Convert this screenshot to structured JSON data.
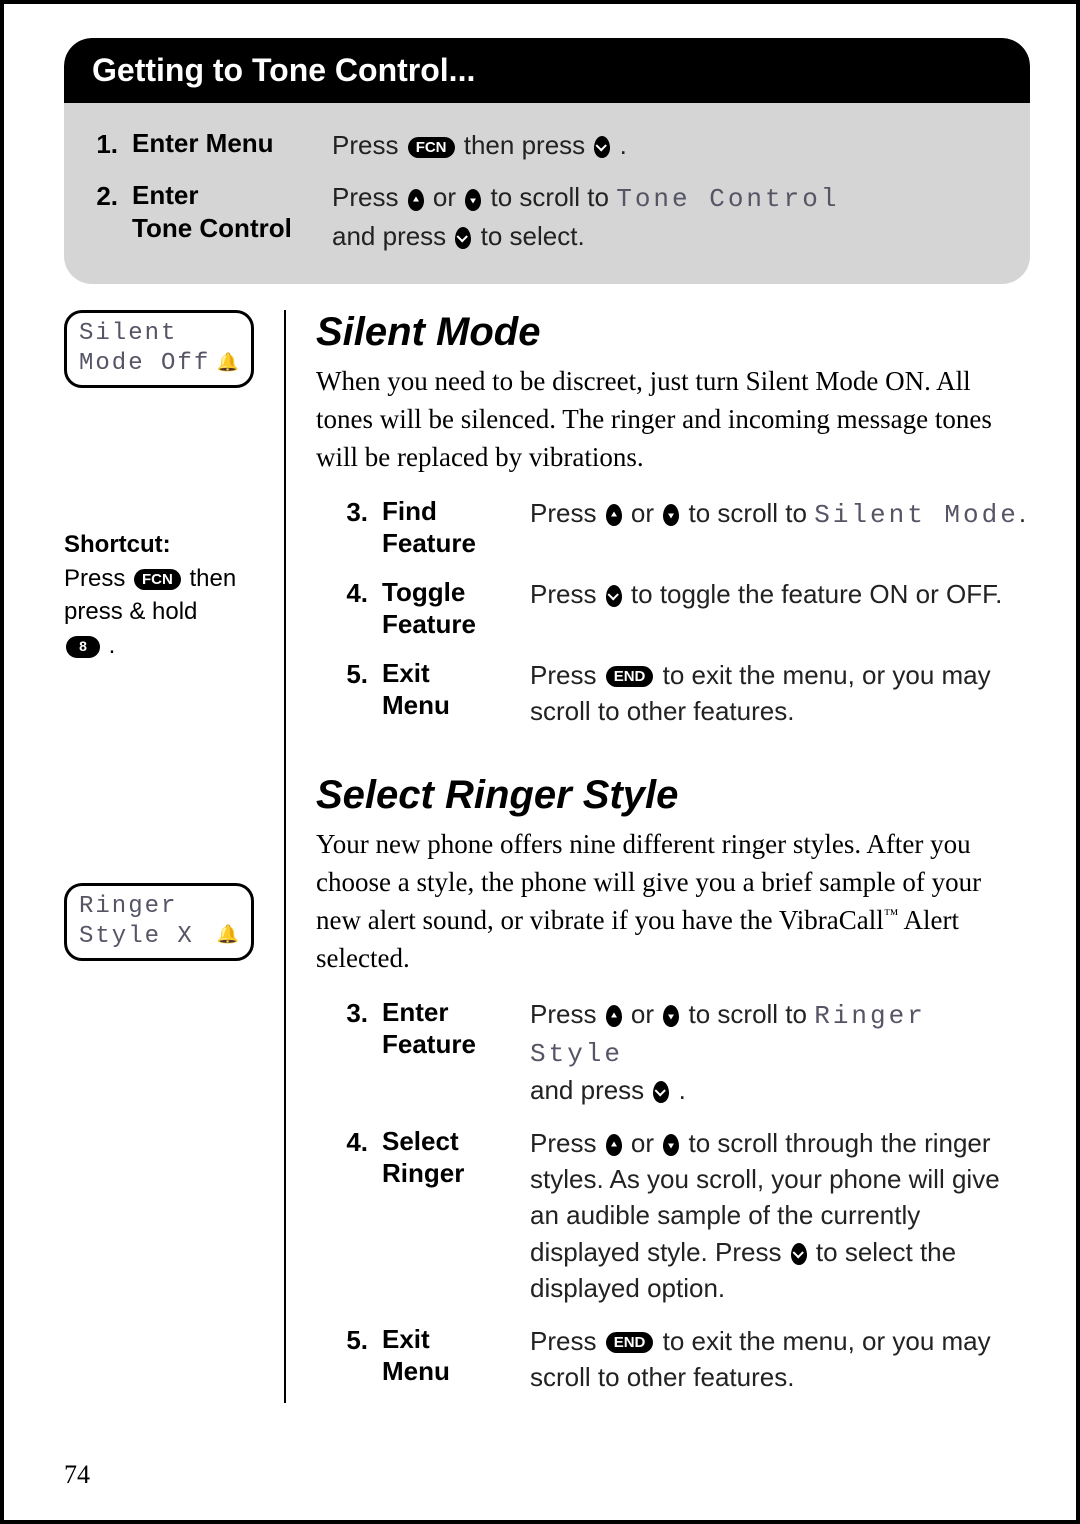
{
  "page_number": "74",
  "card": {
    "title": "Getting to Tone Control...",
    "steps": [
      {
        "num": "1.",
        "title": "Enter Menu",
        "desc_pre": "Press ",
        "key1": "FCN",
        "desc_mid": " then press ",
        "desc_post": "."
      },
      {
        "num": "2.",
        "title_line1": "Enter",
        "title_line2": "Tone Control",
        "desc_pre": "Press ",
        "desc_mid": " or ",
        "desc_mid2": " to scroll to ",
        "lcd": "Tone Control",
        "line2_pre": "and press ",
        "line2_post": " to select."
      }
    ]
  },
  "sidebar": {
    "lcd1": {
      "l1": "Silent",
      "l2": "Mode Off"
    },
    "shortcut": {
      "heading": "Shortcut:",
      "l1_pre": "Press ",
      "l1_key": "FCN",
      "l1_post": " then",
      "l2": "press & hold",
      "l3_key": "8",
      "l3_post": "."
    },
    "lcd2": {
      "l1": "Ringer",
      "l2": "Style X"
    }
  },
  "silent": {
    "heading": "Silent Mode",
    "lead": "When you need to be discreet, just turn Silent Mode ON. All tones will be silenced. The ringer and incoming message tones will be replaced by vibrations.",
    "steps": [
      {
        "num": "3.",
        "title_l1": "Find",
        "title_l2": "Feature",
        "d_pre": "Press ",
        "d_mid": " or ",
        "d_mid2": " to scroll to ",
        "lcd": "Silent Mode",
        "d_post": "."
      },
      {
        "num": "4.",
        "title_l1": "Toggle",
        "title_l2": "Feature",
        "d_pre": "Press ",
        "d_post": " to toggle the feature ON or OFF."
      },
      {
        "num": "5.",
        "title_l1": "Exit",
        "title_l2": "Menu",
        "d_pre": "Press ",
        "key": "END",
        "d_post": " to exit the menu, or you may scroll to other features."
      }
    ]
  },
  "ringer": {
    "heading": "Select Ringer Style",
    "lead_pre": "Your new phone offers nine different ringer styles. After you choose a style, the phone will give you a brief sample of your new alert sound, or vibrate if you have the VibraCall",
    "tm": "™",
    "lead_post": " Alert selected.",
    "steps": [
      {
        "num": "3.",
        "title_l1": "Enter",
        "title_l2": "Feature",
        "d_pre": "Press ",
        "d_mid": " or ",
        "d_mid2": " to scroll to ",
        "lcd": "Ringer Style",
        "l2_pre": "and press ",
        "l2_post": "."
      },
      {
        "num": "4.",
        "title_l1": "Select",
        "title_l2": "Ringer",
        "d_pre": "Press ",
        "d_mid": " or ",
        "d_mid2": " to scroll through the ringer styles. As you scroll, your phone will give an audible sample of the currently displayed style. Press ",
        "d_post": " to select the displayed option."
      },
      {
        "num": "5.",
        "title_l1": "Exit",
        "title_l2": "Menu",
        "d_pre": "Press ",
        "key": "END",
        "d_post": " to exit the menu, or you may scroll to other features."
      }
    ]
  }
}
